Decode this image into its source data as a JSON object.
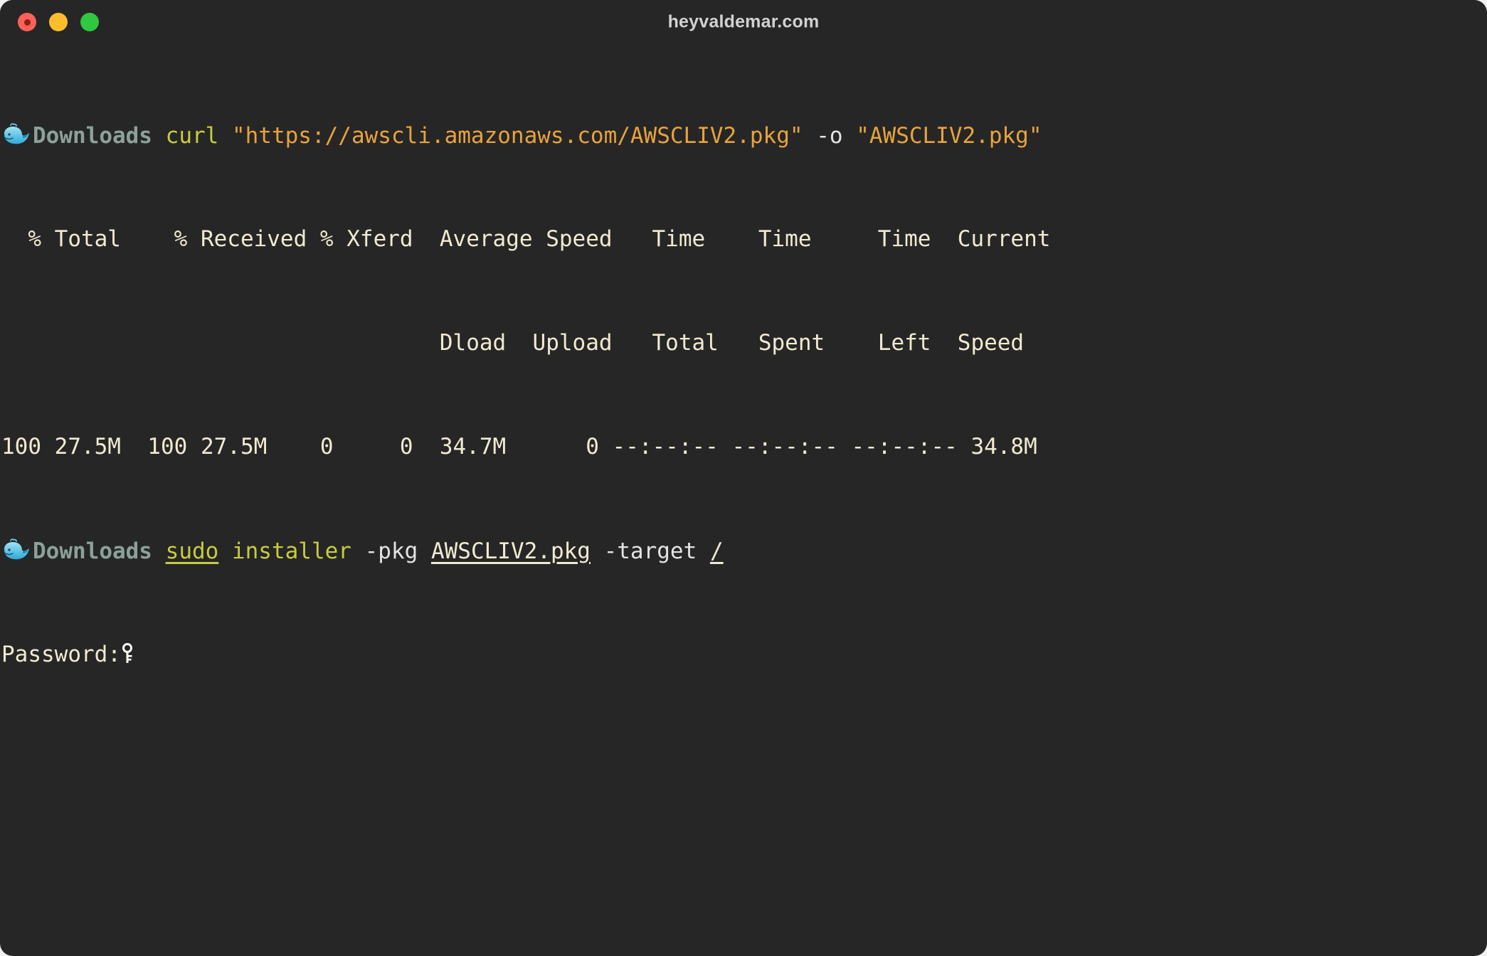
{
  "window": {
    "title": "heyvaldemar.com",
    "background_color": "#262626",
    "traffic_lights": [
      {
        "name": "close",
        "color": "#ff6159"
      },
      {
        "name": "minimize",
        "color": "#ffbd2e"
      },
      {
        "name": "maximize",
        "color": "#2fc840"
      }
    ]
  },
  "terminal": {
    "prompt_dir": "Downloads",
    "prompt_icon": "whale-emoji",
    "line1": {
      "command": "curl",
      "url_arg": "\"https://awscli.amazonaws.com/AWSCLIV2.pkg\"",
      "flag": "-o",
      "output_arg": "\"AWSCLIV2.pkg\""
    },
    "progress_header_1": "  % Total    % Received % Xferd  Average Speed   Time    Time     Time  Current",
    "progress_header_2": "                                 Dload  Upload   Total   Spent    Left  Speed",
    "progress_row": "100 27.5M  100 27.5M    0     0  34.7M      0 --:--:-- --:--:-- --:--:-- 34.8M",
    "line2": {
      "sudo": "sudo",
      "command": "installer",
      "flag_pkg": "-pkg",
      "pkg_path": "AWSCLIV2.pkg",
      "flag_target": "-target",
      "target_path": "/"
    },
    "password_prompt": "Password:",
    "password_icon": "key-emoji"
  },
  "colors": {
    "background": "#262626",
    "prompt_dir": "#8ba19a",
    "command": "#c8cc40",
    "string": "#e8a33d",
    "plain": "#e3e3e3",
    "output": "#f1ead1"
  }
}
